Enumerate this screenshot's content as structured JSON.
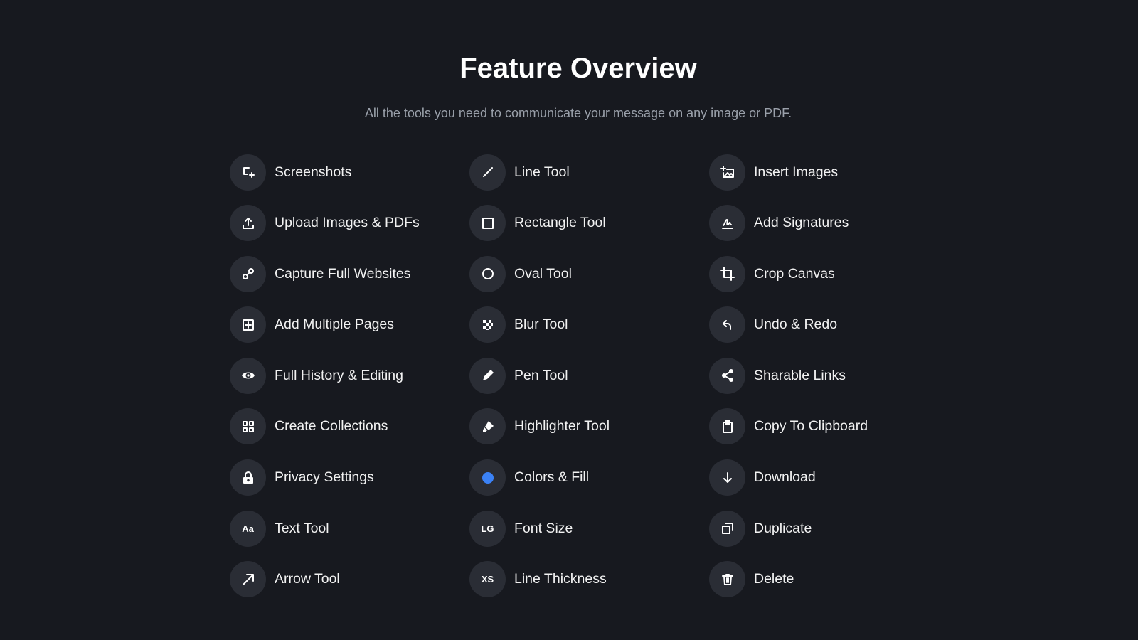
{
  "header": {
    "title": "Feature Overview",
    "subtitle": "All the tools you need to communicate your message on any image or PDF."
  },
  "colors": {
    "background": "#17191f",
    "icon_circle": "#2a2d35",
    "accent_blue": "#3b82f6"
  },
  "features": [
    {
      "label": "Screenshots",
      "icon": "screenshot-add-icon"
    },
    {
      "label": "Line Tool",
      "icon": "line-icon"
    },
    {
      "label": "Insert Images",
      "icon": "insert-image-icon"
    },
    {
      "label": "Upload Images & PDFs",
      "icon": "upload-icon"
    },
    {
      "label": "Rectangle Tool",
      "icon": "rectangle-icon"
    },
    {
      "label": "Add Signatures",
      "icon": "signature-icon"
    },
    {
      "label": "Capture Full Websites",
      "icon": "link-icon"
    },
    {
      "label": "Oval Tool",
      "icon": "circle-icon"
    },
    {
      "label": "Crop Canvas",
      "icon": "crop-icon"
    },
    {
      "label": "Add Multiple Pages",
      "icon": "add-page-icon"
    },
    {
      "label": "Blur Tool",
      "icon": "checker-blur-icon"
    },
    {
      "label": "Undo & Redo",
      "icon": "undo-icon"
    },
    {
      "label": "Full History & Editing",
      "icon": "eye-icon"
    },
    {
      "label": "Pen Tool",
      "icon": "pen-icon"
    },
    {
      "label": "Sharable Links",
      "icon": "share-icon"
    },
    {
      "label": "Create Collections",
      "icon": "grid-icon"
    },
    {
      "label": "Highlighter Tool",
      "icon": "highlighter-icon"
    },
    {
      "label": "Copy To Clipboard",
      "icon": "clipboard-icon"
    },
    {
      "label": "Privacy Settings",
      "icon": "lock-icon"
    },
    {
      "label": "Colors & Fill",
      "icon": "color-dot-icon"
    },
    {
      "label": "Download",
      "icon": "download-icon"
    },
    {
      "label": "Text Tool",
      "icon": "text-aa-icon",
      "icon_text": "Aa"
    },
    {
      "label": "Font Size",
      "icon": "font-size-icon",
      "icon_text": "LG"
    },
    {
      "label": "Duplicate",
      "icon": "duplicate-icon"
    },
    {
      "label": "Arrow Tool",
      "icon": "arrow-icon"
    },
    {
      "label": "Line Thickness",
      "icon": "line-thickness-icon",
      "icon_text": "XS"
    },
    {
      "label": "Delete",
      "icon": "trash-icon"
    }
  ]
}
